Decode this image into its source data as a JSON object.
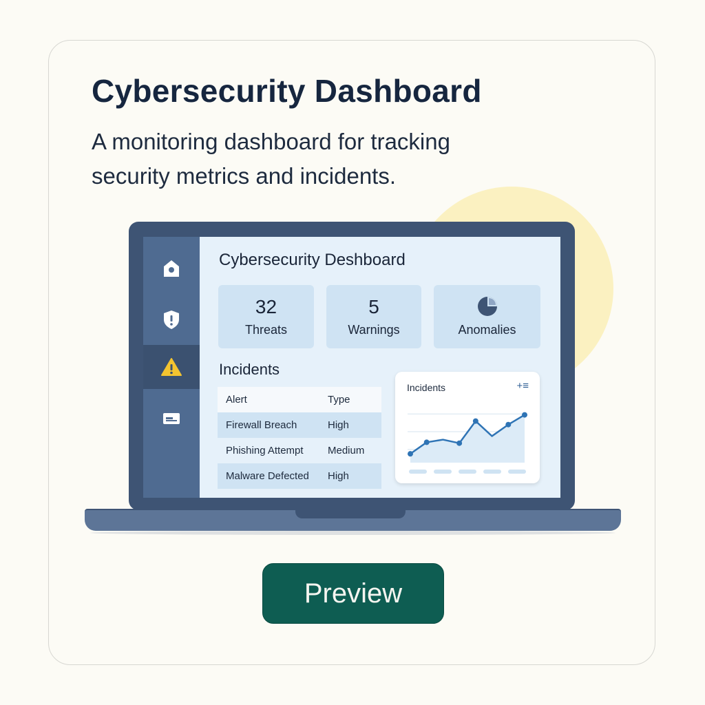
{
  "card": {
    "title": "Cybersecurity Dashboard",
    "description": "A monitoring dashboard for tracking security metrics and incidents.",
    "button_label": "Preview"
  },
  "colors": {
    "accent": "#0e5d52",
    "sidebar": "#4f6b91",
    "screen_bg": "#e6f1fa",
    "tile_bg": "#cfe3f3",
    "sun": "#fbf1c1",
    "warning": "#f4c430",
    "chart_line": "#2f74b5"
  },
  "dashboard": {
    "title": "Cybersecurity Deshboard",
    "sidebar": [
      {
        "icon": "home-icon",
        "active": false
      },
      {
        "icon": "shield-icon",
        "active": false
      },
      {
        "icon": "warning-icon",
        "active": true
      },
      {
        "icon": "card-icon",
        "active": false
      }
    ],
    "stats": [
      {
        "value": "32",
        "label": "Threats"
      },
      {
        "value": "5",
        "label": "Warnings"
      },
      {
        "icon": "pie-chart-icon",
        "label": "Anomalies"
      }
    ],
    "incidents_title": "Incidents",
    "table": {
      "columns": [
        "Alert",
        "Type"
      ],
      "rows": [
        {
          "alert": "Firewall Breach",
          "type": "High"
        },
        {
          "alert": "Phishing Attempt",
          "type": "Medium"
        },
        {
          "alert": "Malware Defected",
          "type": "High"
        }
      ]
    },
    "chart_card": {
      "title": "Incidents",
      "menu_icon": "+≡"
    }
  },
  "chart_data": {
    "type": "area",
    "title": "Incidents",
    "xlabel": "",
    "ylabel": "",
    "x": [
      1,
      2,
      3,
      4,
      5,
      6,
      7,
      8
    ],
    "values": [
      1,
      2.3,
      2.6,
      2.2,
      4.7,
      3.0,
      4.3,
      5.4
    ],
    "ylim": [
      0,
      7
    ],
    "grid": true,
    "legend": "none"
  }
}
